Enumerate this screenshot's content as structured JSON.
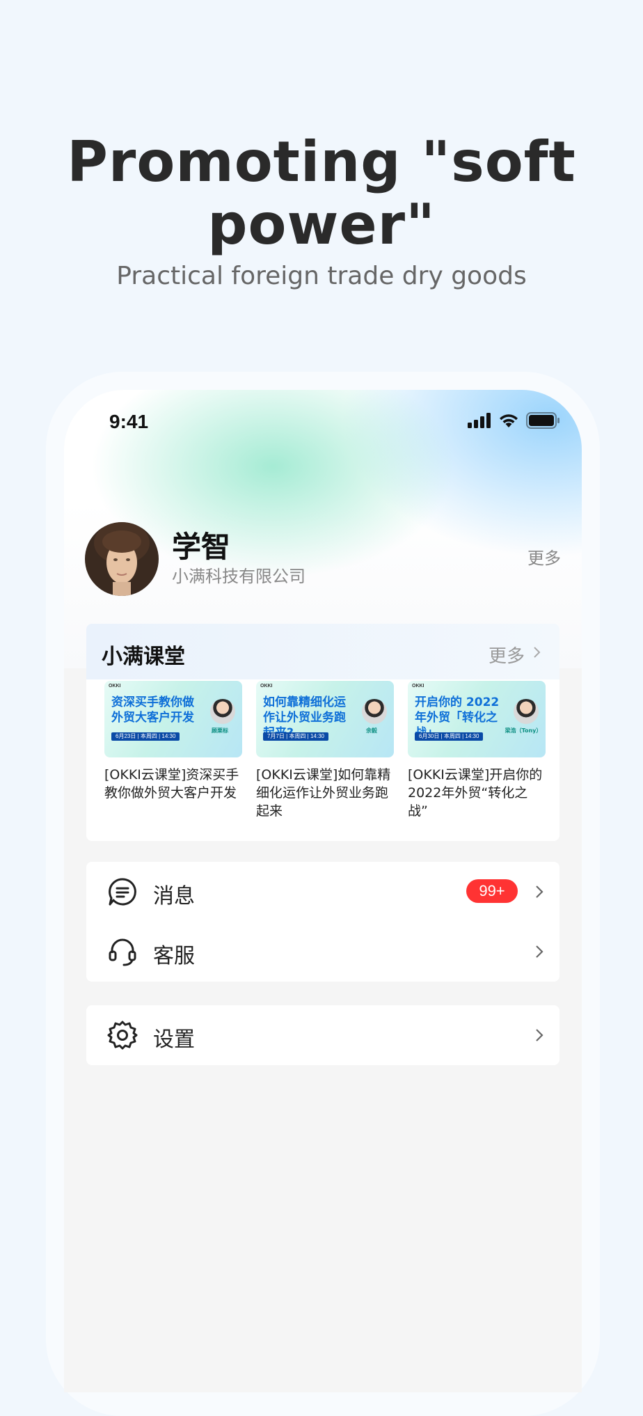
{
  "hero": {
    "title": "Promoting \"soft power\"",
    "subtitle": "Practical foreign trade dry goods"
  },
  "status_bar": {
    "time": "9:41",
    "icons": [
      "signal-icon",
      "wifi-icon",
      "battery-icon"
    ]
  },
  "profile": {
    "name": "学智",
    "company": "小满科技有限公司",
    "more": "更多"
  },
  "course": {
    "title": "小满课堂",
    "more": "更多",
    "items": [
      {
        "caption": "[OKKI云课堂]资深买手教你做外贸大客户开发",
        "thumb_text": "资深买手教你做外贸大客户开发",
        "thumb_date": "6月23日 | 本周四 | 14:30",
        "thumb_person": "顾栗标"
      },
      {
        "caption": "[OKKI云课堂]如何靠精细化运作让外贸业务跑起来",
        "thumb_text": "如何靠精细化运作让外贸业务跑起来?",
        "thumb_date": "7月7日 | 本周四 | 14:30",
        "thumb_person": "余毅"
      },
      {
        "caption": "[OKKI云课堂]开启你的2022年外贸“转化之战”",
        "thumb_text": "开启你的 2022年外贸「转化之战」",
        "thumb_date": "6月30日 | 本周四 | 14:30",
        "thumb_person": "梁浩（Tony）"
      }
    ],
    "thumb_logo": "OKKI"
  },
  "menu": {
    "messages": {
      "label": "消息",
      "badge": "99+"
    },
    "service": {
      "label": "客服"
    },
    "settings": {
      "label": "设置"
    }
  },
  "colors": {
    "accent_blue": "#0e6fd8",
    "badge_red": "#ff3333",
    "page_bg": "#f1f7fd"
  }
}
